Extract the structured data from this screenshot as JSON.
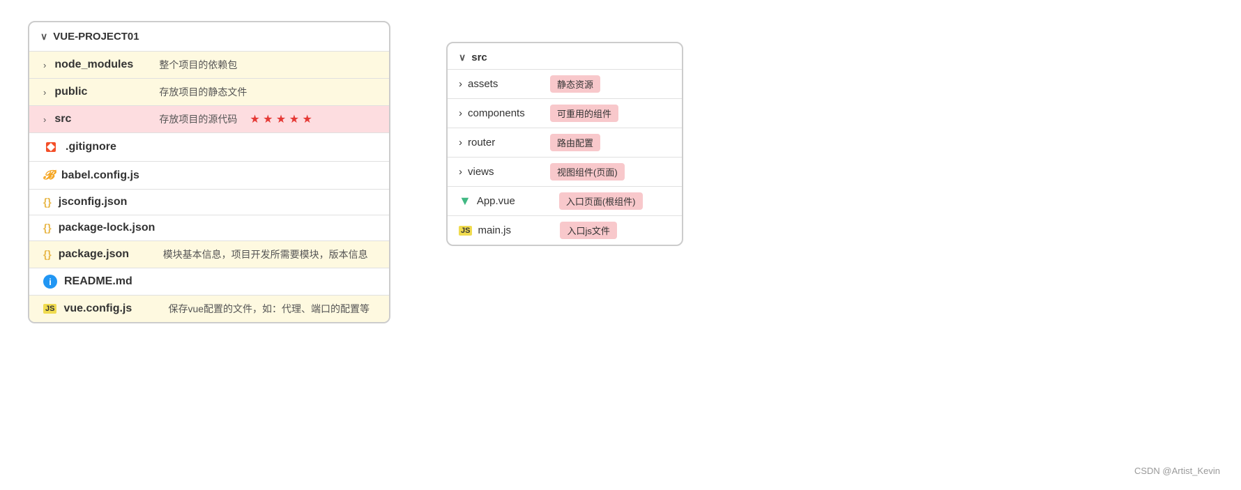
{
  "leftPanel": {
    "header": "VUE-PROJECT01",
    "items": [
      {
        "type": "folder",
        "name": "node_modules",
        "description": "整个项目的依赖包",
        "highlight": "yellow",
        "icon": "folder-chevron"
      },
      {
        "type": "folder",
        "name": "public",
        "description": "存放项目的静态文件",
        "highlight": "yellow",
        "icon": "folder-chevron"
      },
      {
        "type": "folder",
        "name": "src",
        "description": "存放项目的源代码",
        "highlight": "pink",
        "icon": "folder-chevron",
        "stars": "★ ★ ★ ★ ★"
      },
      {
        "type": "file",
        "name": ".gitignore",
        "icon": "git",
        "highlight": "none"
      },
      {
        "type": "file",
        "name": "babel.config.js",
        "icon": "babel",
        "highlight": "none"
      },
      {
        "type": "file",
        "name": "jsconfig.json",
        "icon": "json",
        "highlight": "none"
      },
      {
        "type": "file",
        "name": "package-lock.json",
        "icon": "json",
        "highlight": "none"
      },
      {
        "type": "file",
        "name": "package.json",
        "description": "模块基本信息，项目开发所需要模块，版本信息",
        "icon": "json",
        "highlight": "yellow"
      },
      {
        "type": "file",
        "name": "README.md",
        "icon": "readme",
        "highlight": "none"
      },
      {
        "type": "file",
        "name": "vue.config.js",
        "description": "保存vue配置的文件，如：代理、端口的配置等",
        "icon": "js",
        "highlight": "yellow"
      }
    ]
  },
  "rightPanel": {
    "header": "src",
    "items": [
      {
        "type": "folder",
        "name": "assets",
        "badge": "静态资源",
        "icon": "folder-chevron"
      },
      {
        "type": "folder",
        "name": "components",
        "badge": "可重用的组件",
        "icon": "folder-chevron"
      },
      {
        "type": "folder",
        "name": "router",
        "badge": "路由配置",
        "icon": "folder-chevron"
      },
      {
        "type": "folder",
        "name": "views",
        "badge": "视图组件(页面)",
        "icon": "folder-chevron"
      },
      {
        "type": "file",
        "name": "App.vue",
        "badge": "入口页面(根组件)",
        "icon": "vue"
      },
      {
        "type": "file",
        "name": "main.js",
        "badge": "入口js文件",
        "icon": "js"
      }
    ]
  },
  "watermark": "CSDN @Artist_Kevin"
}
